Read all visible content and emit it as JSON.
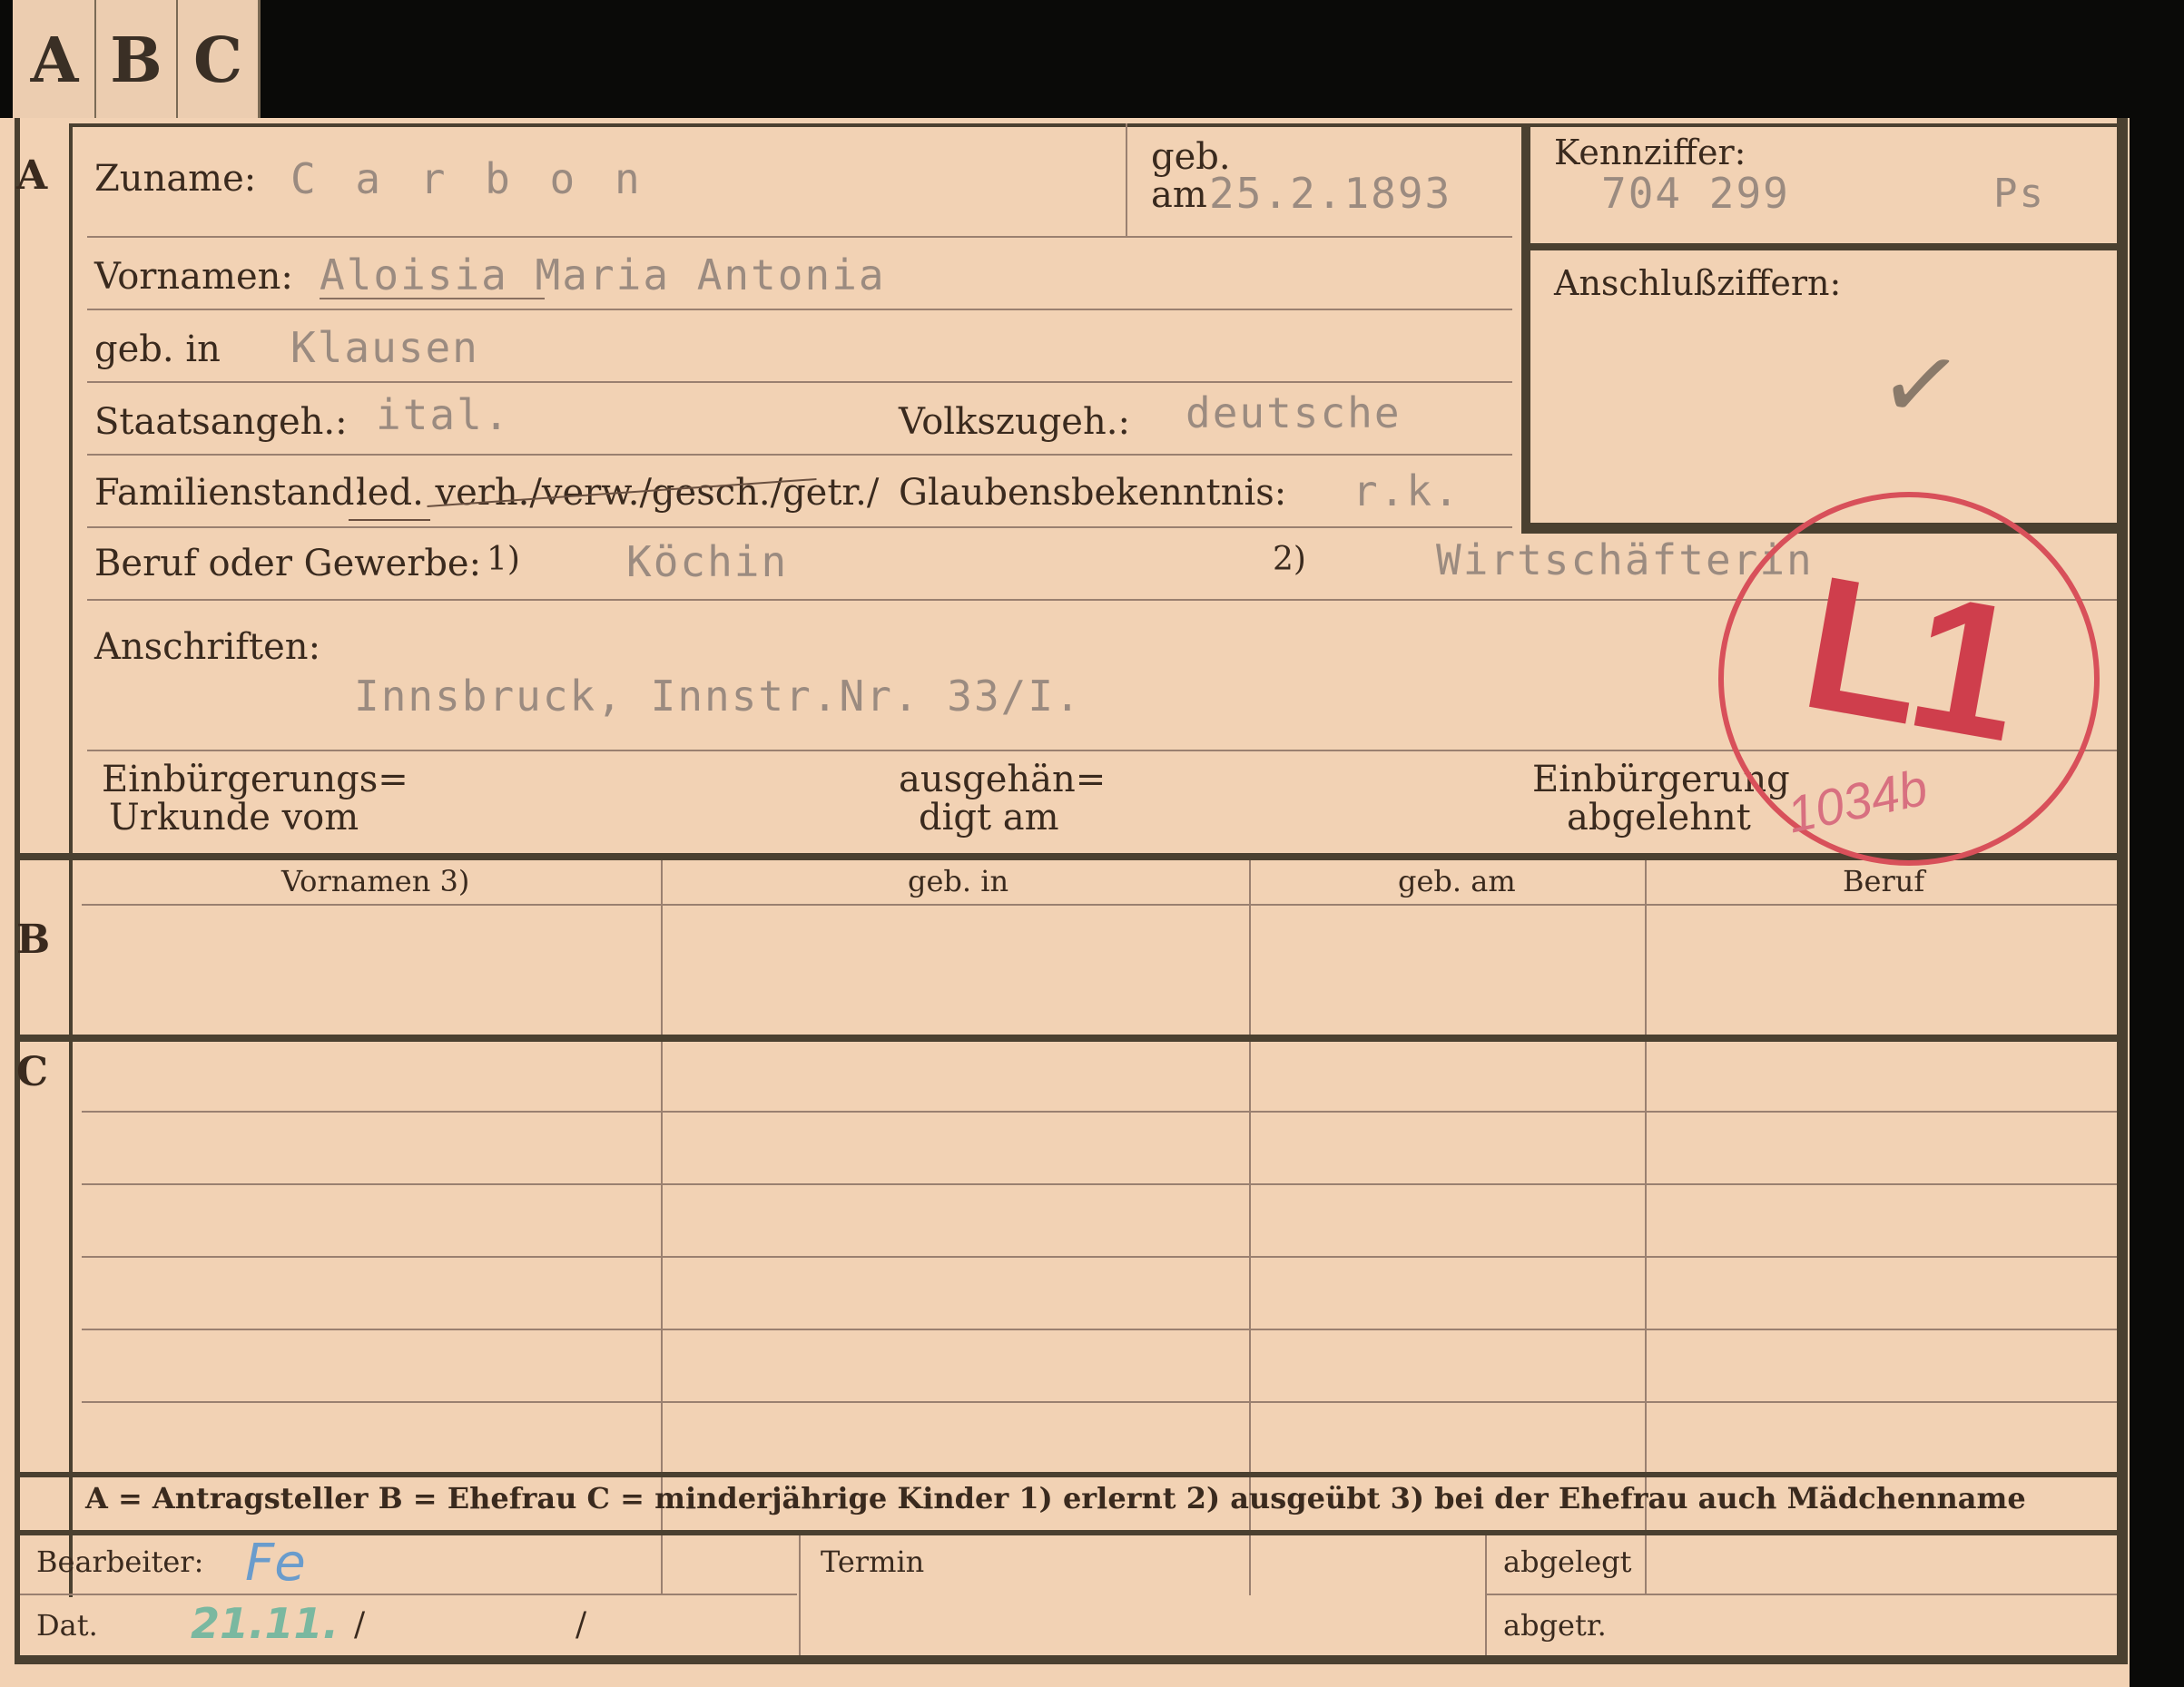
{
  "tabs": [
    "A",
    "B",
    "C"
  ],
  "section_labels": {
    "a": "A",
    "b": "B",
    "c": "C"
  },
  "labels": {
    "zuname": "Zuname:",
    "geb": "geb.",
    "am": "am",
    "kennziffer": "Kennziffer:",
    "anschlussziffern": "Anschlußziffern:",
    "vornamen": "Vornamen:",
    "geb_in": "geb. in",
    "staatsangeh": "Staatsangeh.:",
    "volkszugeh": "Volkszugeh.:",
    "familienstand": "Familienstand:",
    "glaubensbekenntnis": "Glaubensbekenntnis:",
    "beruf": "Beruf oder Gewerbe:",
    "beruf_note1": "1)",
    "beruf_note2": "2)",
    "anschriften": "Anschriften:",
    "einbuergerungs_1": "Einbürgerungs=",
    "einbuergerungs_2": "Urkunde vom",
    "ausgehaen_1": "ausgehän=",
    "ausgehaen_2": "digt am",
    "einbuergerung_1": "Einbürgerung",
    "einbuergerung_2": "abgelehnt"
  },
  "person": {
    "zuname": "C a r b o n",
    "geb_am": "25.2.1893",
    "kennziffer": "704 299",
    "kennziffer_suffix": "Ps",
    "vornamen": "Aloisia Maria Antonia",
    "geb_in": "Klausen",
    "staatsangeh": "ital.",
    "volkszugeh": "deutsche",
    "familienstand_options": "led. verh./verw./gesch./getr./",
    "glaubensbekenntnis": "r.k.",
    "beruf_erlernt": "Köchin",
    "beruf_ausgeuebt": "Wirtschäfterin",
    "anschrift": "Innsbruck, Innstr.Nr. 33/I."
  },
  "family_table": {
    "headers": [
      "Vornamen 3)",
      "geb. in",
      "geb. am",
      "Beruf"
    ]
  },
  "legend": "A = Antragsteller   B = Ehefrau   C = minderjährige Kinder   1) erlernt   2) ausgeübt   3) bei der Ehefrau auch Mädchenname",
  "footer": {
    "bearbeiter_label": "Bearbeiter:",
    "bearbeiter_value": "Fe",
    "dat_label": "Dat.",
    "dat_value": "21.11.",
    "dat_slash1": "/",
    "dat_slash2": "/",
    "termin_label": "Termin",
    "abgelegt_label": "abgelegt",
    "abgetr_label": "abgetr."
  },
  "stamp": {
    "big": "L1",
    "small": "1034b"
  },
  "checkmark": "✓",
  "colors": {
    "card": "#f2d2b4",
    "stamp": "#d8505a",
    "pencil_blue": "#6a9ccc",
    "pencil_green": "#7ab8a0"
  }
}
